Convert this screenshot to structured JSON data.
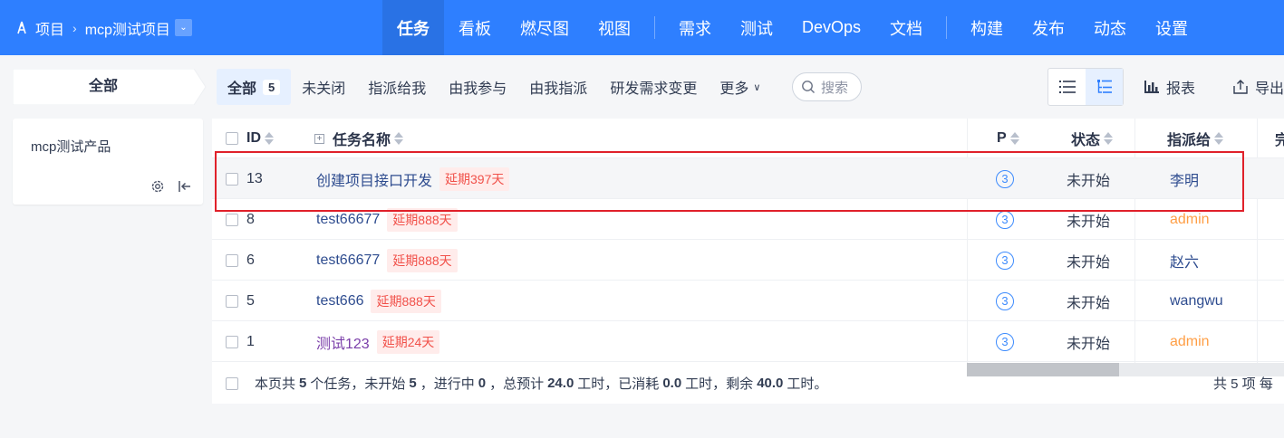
{
  "topbar": {
    "breadcrumb_root": "项目",
    "project_name": "mcp测试项目",
    "nav": [
      "任务",
      "看板",
      "燃尽图",
      "视图",
      "需求",
      "测试",
      "DevOps",
      "文档",
      "构建",
      "发布",
      "动态",
      "设置"
    ],
    "active_nav": "任务"
  },
  "filter": {
    "all_pill": "全部",
    "active_tab": "全部",
    "active_count": "5",
    "tabs": [
      "未关闭",
      "指派给我",
      "由我参与",
      "由我指派",
      "研发需求变更"
    ],
    "more": "更多",
    "search_placeholder": "搜索"
  },
  "toolbar": {
    "report": "报表",
    "export": "导出"
  },
  "sidebar": {
    "product": "mcp测试产品"
  },
  "table": {
    "headers": {
      "id": "ID",
      "name": "任务名称",
      "pri": "P",
      "status": "状态",
      "assignee": "指派给",
      "finished": "完"
    },
    "rows": [
      {
        "id": "13",
        "name": "创建项目接口开发",
        "delay": "延期397天",
        "pri": "3",
        "status": "未开始",
        "assignee": "李明"
      },
      {
        "id": "8",
        "name": "test66677",
        "delay": "延期888天",
        "pri": "3",
        "status": "未开始",
        "assignee": "admin"
      },
      {
        "id": "6",
        "name": "test66677",
        "delay": "延期888天",
        "pri": "3",
        "status": "未开始",
        "assignee": "赵六"
      },
      {
        "id": "5",
        "name": "test666",
        "delay": "延期888天",
        "pri": "3",
        "status": "未开始",
        "assignee": "wangwu"
      },
      {
        "id": "1",
        "name": "测试123",
        "delay": "延期24天",
        "pri": "3",
        "status": "未开始",
        "assignee": "admin"
      }
    ]
  },
  "footer": {
    "summary_parts": [
      "本页共",
      "5",
      "个任务，未开始",
      "5",
      "，进行中",
      "0",
      "，总预计",
      "24.0",
      "工时，已消耗",
      "0.0",
      "工时，剩余",
      "40.0",
      "工时。"
    ],
    "pager": "共 5 项   每"
  },
  "colors": {
    "primary": "#2e7fff",
    "delay_bg": "#ffeceb",
    "delay_text": "#f1514a",
    "admin": "#ff9f46",
    "highlight_box": "#e0212a"
  }
}
